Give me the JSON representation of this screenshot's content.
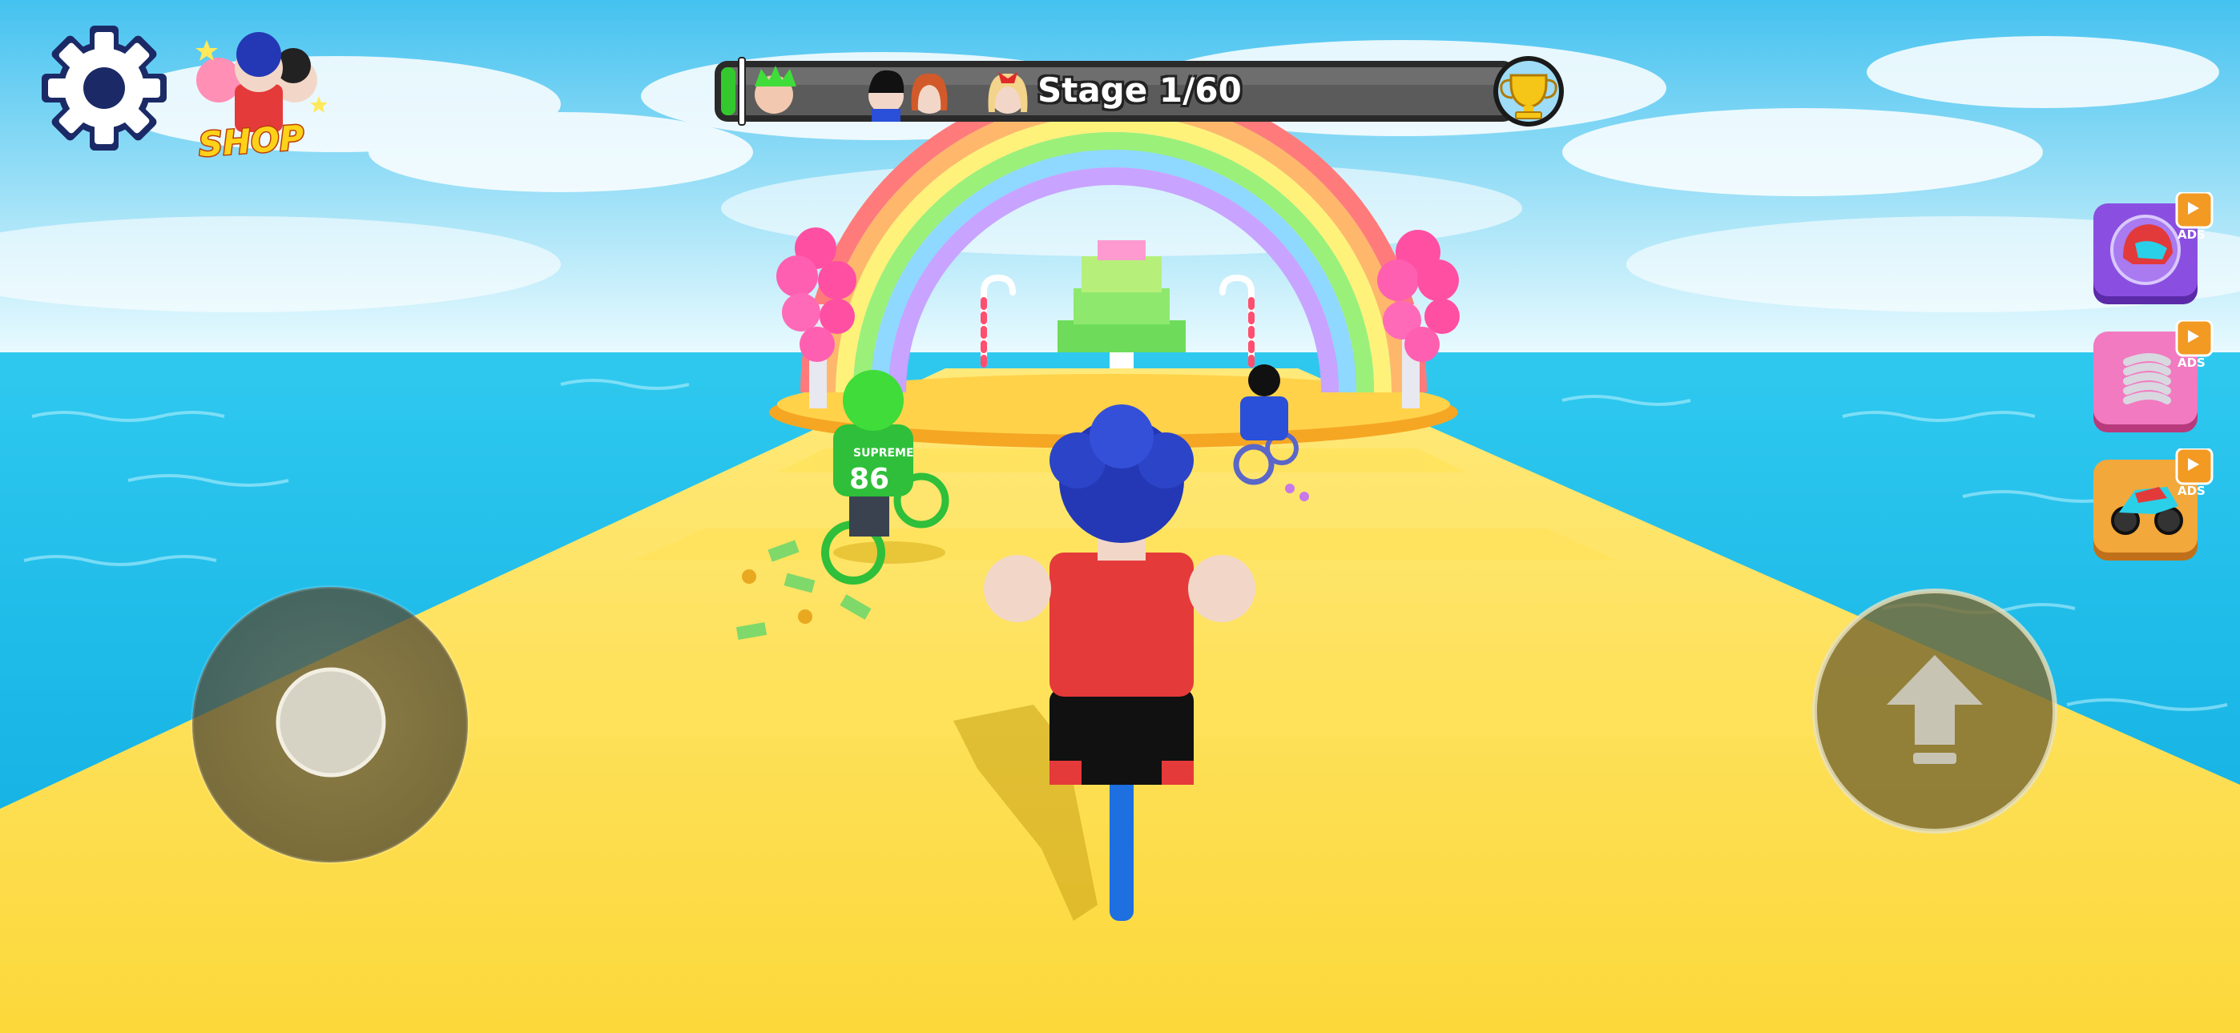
{
  "hud": {
    "shop_label": "SHOP",
    "stage_text": "Stage 1/60",
    "stage_progress_fraction": 0.017,
    "settings_icon": "gear-icon",
    "trophy_icon": "trophy-icon",
    "jump_icon": "up-arrow-icon"
  },
  "side_offers": [
    {
      "icon": "helmet-icon",
      "badge": "ADS",
      "color": "#8a4fe0"
    },
    {
      "icon": "spring-icon",
      "badge": "ADS",
      "color": "#e85aa8"
    },
    {
      "icon": "motorbike-icon",
      "badge": "ADS",
      "color": "#f29a22"
    }
  ],
  "racers": [
    {
      "name": "green-hair-racer",
      "jersey_text": "SUPREME",
      "jersey_number": "86",
      "jersey_color": "#2fbf3a"
    },
    {
      "name": "blue-suit-racer",
      "jersey_color": "#2a4fd8"
    },
    {
      "name": "player-racer",
      "shirt_color": "#e53a3a",
      "hair_color": "#2438b5"
    }
  ],
  "colors": {
    "sky_top": "#52c8f2",
    "sea": "#1fb8e8",
    "track": "#fcd93e",
    "hud_bar": "#5b5b5b",
    "progress_green": "#33c92e"
  }
}
